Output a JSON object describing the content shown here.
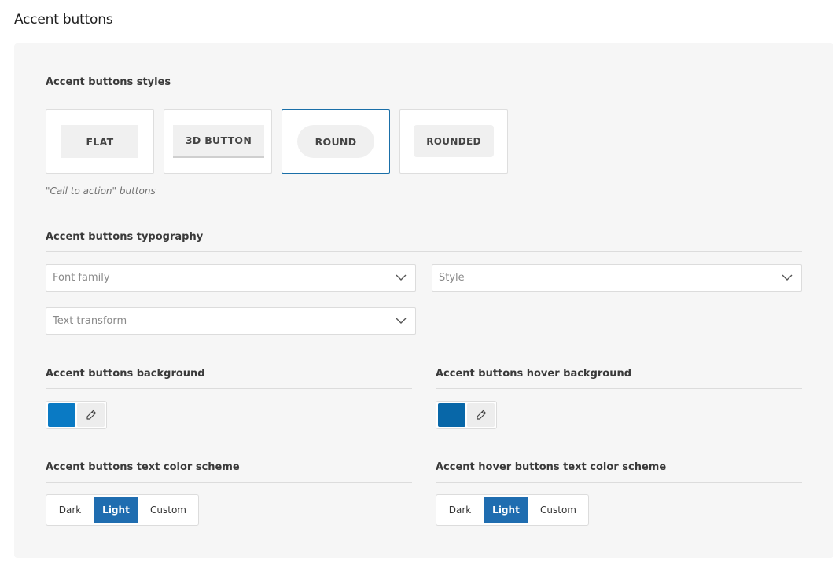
{
  "page": {
    "title": "Accent buttons"
  },
  "styles": {
    "label": "Accent buttons styles",
    "selected": "round",
    "options": [
      {
        "id": "flat",
        "label": "FLAT"
      },
      {
        "id": "3d",
        "label": "3D BUTTON"
      },
      {
        "id": "round",
        "label": "ROUND"
      },
      {
        "id": "rounded",
        "label": "ROUNDED"
      }
    ],
    "hint": "\"Call to action\" buttons"
  },
  "typography": {
    "label": "Accent buttons typography",
    "font_family_placeholder": "Font family",
    "style_placeholder": "Style",
    "text_transform_placeholder": "Text transform"
  },
  "background": {
    "label": "Accent buttons background",
    "color": "#0a7ac4"
  },
  "hover_background": {
    "label": "Accent buttons hover background",
    "color": "#0867a8"
  },
  "text_scheme": {
    "label": "Accent buttons text color scheme",
    "options": [
      "Dark",
      "Light",
      "Custom"
    ],
    "selected": "Light"
  },
  "hover_text_scheme": {
    "label": "Accent hover buttons text color scheme",
    "options": [
      "Dark",
      "Light",
      "Custom"
    ],
    "selected": "Light"
  },
  "colors": {
    "accent_selected": "#1a6fa8",
    "segment_active": "#1f6db0"
  },
  "icons": {
    "dropdown": "chevron-down-icon",
    "picker": "eyedropper-icon"
  }
}
